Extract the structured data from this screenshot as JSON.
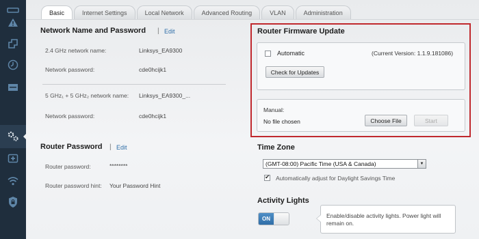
{
  "sidebar": {
    "icons": [
      "warning-icon",
      "connectivity-icon",
      "clock-icon",
      "storage-icon",
      "settings-gear-icon",
      "add-device-icon",
      "wifi-icon",
      "security-lock-icon"
    ],
    "active": "settings-gear-icon"
  },
  "tabs": [
    "Basic",
    "Internet Settings",
    "Local Network",
    "Advanced Routing",
    "VLAN",
    "Administration"
  ],
  "network": {
    "title": "Network Name and Password",
    "edit_label": "Edit",
    "ssid24_label": "2.4 GHz network name:",
    "ssid24_value": "Linksys_EA9300",
    "pwd24_label": "Network password:",
    "pwd24_value": "cde0hcijk1",
    "ssid5_label": "5 GHz₁ + 5 GHz₂ network name:",
    "ssid5_value": "Linksys_EA9300_...",
    "pwd5_label": "Network password:",
    "pwd5_value": "cde0hcijk1"
  },
  "router_password": {
    "title": "Router Password",
    "edit_label": "Edit",
    "pwd_label": "Router password:",
    "pwd_value": "********",
    "hint_label": "Router password hint:",
    "hint_value": "Your Password Hint"
  },
  "firmware": {
    "title": "Router Firmware Update",
    "automatic_label": "Automatic",
    "automatic_checked": false,
    "current_version": "(Current Version: 1.1.9.181086)",
    "check_button": "Check for Updates",
    "manual_label": "Manual:",
    "file_status": "No file chosen",
    "choose_button": "Choose File",
    "start_button": "Start"
  },
  "time_zone": {
    "title": "Time Zone",
    "selected": "(GMT-08:00) Pacific Time (USA & Canada)",
    "dst_label": "Automatically adjust for Daylight Savings Time",
    "dst_checked": true
  },
  "activity_lights": {
    "title": "Activity Lights",
    "toggle_label": "ON",
    "tooltip": "Enable/disable activity lights. Power light will remain on."
  },
  "colors": {
    "sidebar": "#1f2e3d",
    "highlight": "#c0282d",
    "link": "#2f6ea8",
    "toggle_on": "#2f6ea8"
  }
}
